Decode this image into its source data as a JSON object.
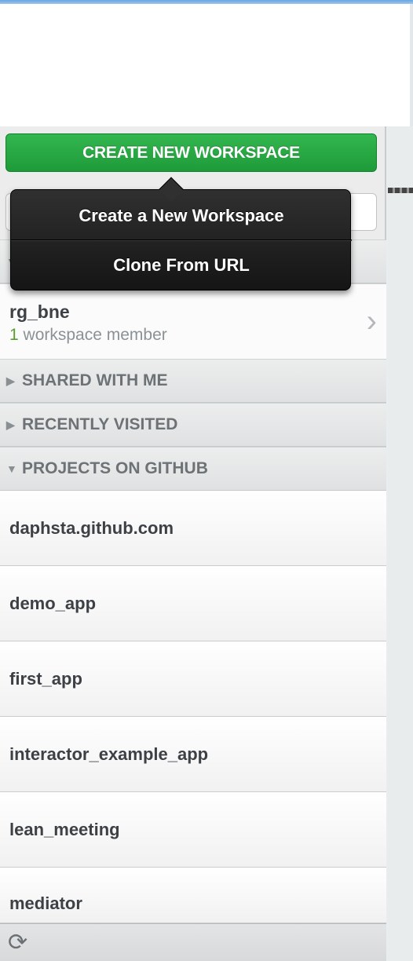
{
  "create_button": {
    "label": "CREATE NEW WORKSPACE"
  },
  "popover": {
    "options": [
      {
        "label": "Create a New Workspace"
      },
      {
        "label": "Clone From URL"
      }
    ]
  },
  "my_workspaces": {
    "items": [
      {
        "name": "rg_bne",
        "member_count": "1",
        "member_text": "workspace member"
      }
    ]
  },
  "sections": {
    "shared": "SHARED WITH ME",
    "recent": "RECENTLY VISITED",
    "github": "PROJECTS ON GITHUB"
  },
  "github_projects": [
    "daphsta.github.com",
    "demo_app",
    "first_app",
    "interactor_example_app",
    "lean_meeting",
    "mediator"
  ],
  "icons": {
    "section_collapsed": "triangle-right-icon",
    "section_expanded": "triangle-down-icon",
    "chevron": "chevron-right-icon",
    "refresh": "refresh-icon"
  },
  "colors": {
    "create_button": "#28a745",
    "member_count": "#5c9e2c",
    "popover": "#1a1a1a"
  }
}
